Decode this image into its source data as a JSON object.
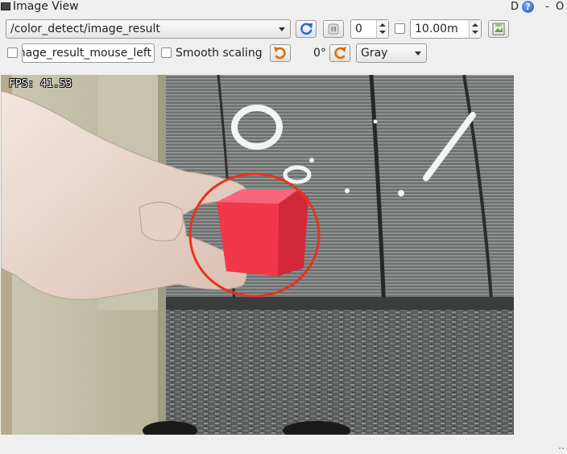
{
  "window": {
    "title": "Image View",
    "d_label": "D",
    "help_label": "?",
    "minimize_label": "-",
    "close_label": "O"
  },
  "toolbar": {
    "topic": "/color_detect/image_result",
    "refresh_icon": "refresh-icon",
    "pause_icon": "pause-icon",
    "num_value": "0",
    "rate_value": "10.00m",
    "save_icon": "save-image-icon"
  },
  "toolbar2": {
    "mouse_topic": "image_result_mouse_left",
    "smooth_scaling_label": "Smooth scaling",
    "rotate_left_icon": "rotate-ccw-icon",
    "rotation_value": "0°",
    "rotate_right_icon": "rotate-cw-icon",
    "color_mode": "Gray"
  },
  "image": {
    "overlay_text": "FPS: 41.53",
    "detection_color": "#e8321e",
    "cube_color": "#f0384a"
  }
}
